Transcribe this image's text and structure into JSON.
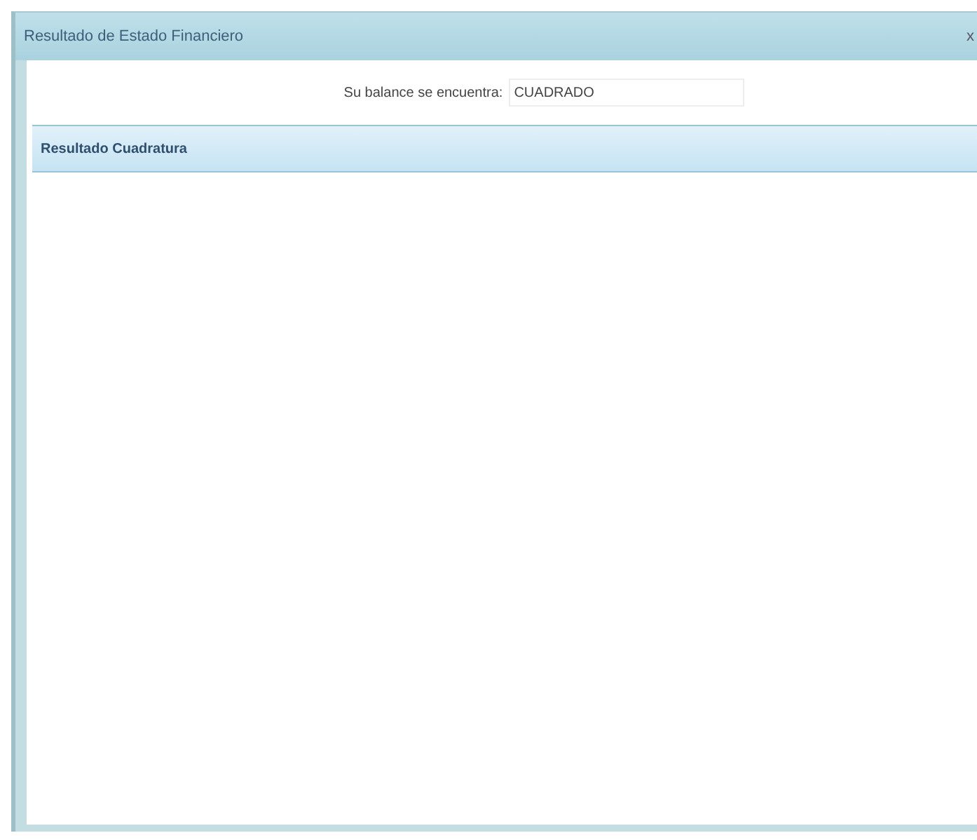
{
  "window": {
    "title": "Resultado de Estado Financiero",
    "close": "x"
  },
  "balance": {
    "label": "Su balance se encuentra:",
    "value": "CUADRADO"
  },
  "panel": {
    "title": "Resultado Cuadratura"
  }
}
